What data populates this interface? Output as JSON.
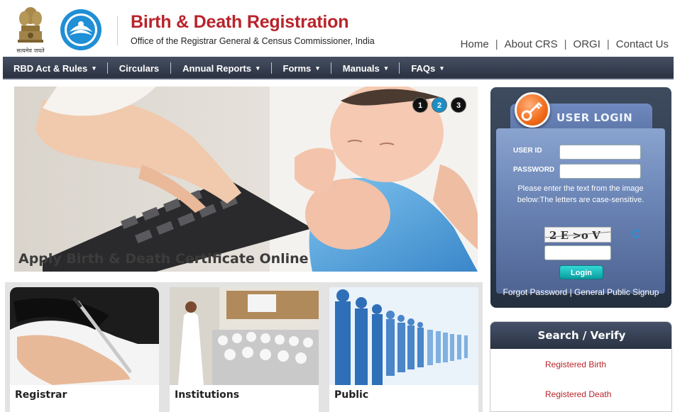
{
  "header": {
    "emblem_text": "सत्यमेव जयते",
    "title": "Birth & Death Registration",
    "subtitle": "Office of the Registrar General & Census Commissioner, India",
    "title_color": "#b8242b",
    "top_links": [
      "Home",
      "About CRS",
      "ORGI",
      "Contact Us"
    ]
  },
  "nav": {
    "items": [
      {
        "label": "RBD Act & Rules",
        "dropdown": true
      },
      {
        "label": "Circulars",
        "dropdown": false
      },
      {
        "label": "Annual Reports",
        "dropdown": true
      },
      {
        "label": "Forms",
        "dropdown": true
      },
      {
        "label": "Manuals",
        "dropdown": true
      },
      {
        "label": "FAQs",
        "dropdown": true
      }
    ],
    "caret": "▾"
  },
  "slider": {
    "caption": "Apply Birth & Death Certificate Online",
    "dots": [
      "1",
      "2",
      "3"
    ],
    "active_dot": "2"
  },
  "tiles": [
    {
      "label": "Registrar"
    },
    {
      "label": "Institutions"
    },
    {
      "label": "Public"
    }
  ],
  "login": {
    "title": "USER LOGIN",
    "user_id_label": "USER ID",
    "password_label": "PASSWORD",
    "note": "Please enter the text from the image below:The letters are case-sensitive.",
    "captcha_text": "2 E >o V",
    "button": "Login",
    "forgot": "Forgot Password",
    "signup": "General Public Signup",
    "sep": "|"
  },
  "search": {
    "title": "Search / Verify",
    "links": [
      "Registered Birth",
      "Registered Death"
    ]
  }
}
